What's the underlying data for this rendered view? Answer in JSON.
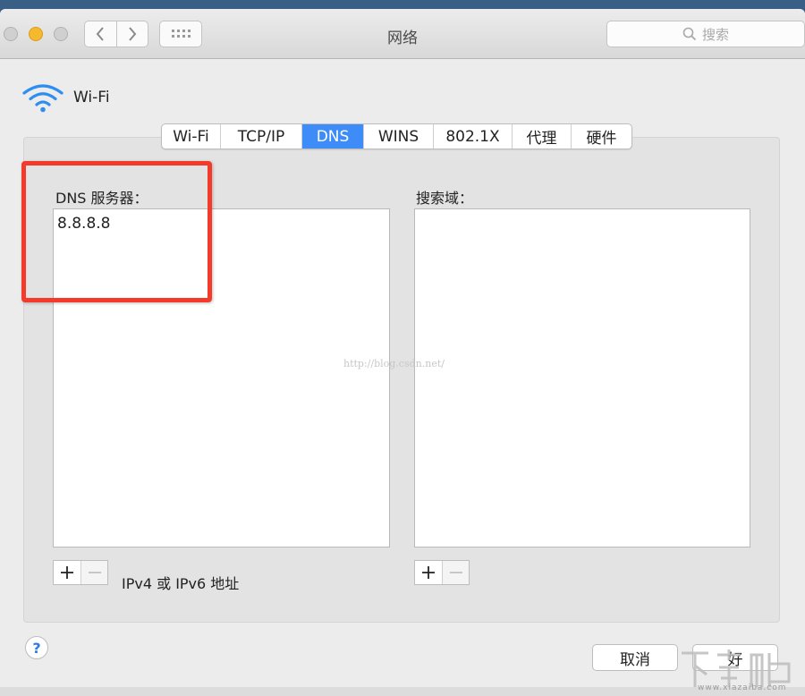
{
  "window": {
    "title": "网络"
  },
  "toolbar": {
    "search_placeholder": "搜索"
  },
  "header": {
    "label": "Wi-Fi"
  },
  "tabs": [
    {
      "label": "Wi-Fi",
      "active": false
    },
    {
      "label": "TCP/IP",
      "active": false
    },
    {
      "label": "DNS",
      "active": true
    },
    {
      "label": "WINS",
      "active": false
    },
    {
      "label": "802.1X",
      "active": false
    },
    {
      "label": "代理",
      "active": false
    },
    {
      "label": "硬件",
      "active": false
    }
  ],
  "dns": {
    "label": "DNS 服务器：",
    "servers": [
      "8.8.8.8"
    ],
    "hint": "IPv4 或 IPv6 地址"
  },
  "search_domains": {
    "label": "搜索域：",
    "items": []
  },
  "watermark": {
    "url": "http://blog.csdn.net/",
    "logo_site": "www.xiazaiba.com"
  },
  "buttons": {
    "help": "?",
    "cancel": "取消",
    "ok": "好"
  },
  "colors": {
    "accent": "#3d8cf7",
    "highlight": "#f43a2a",
    "wifi_icon": "#2e8ef0"
  },
  "icons": [
    "chevron-left-icon",
    "chevron-right-icon",
    "grid-icon",
    "search-icon",
    "wifi-icon",
    "plus-icon",
    "minus-icon",
    "help-icon"
  ]
}
